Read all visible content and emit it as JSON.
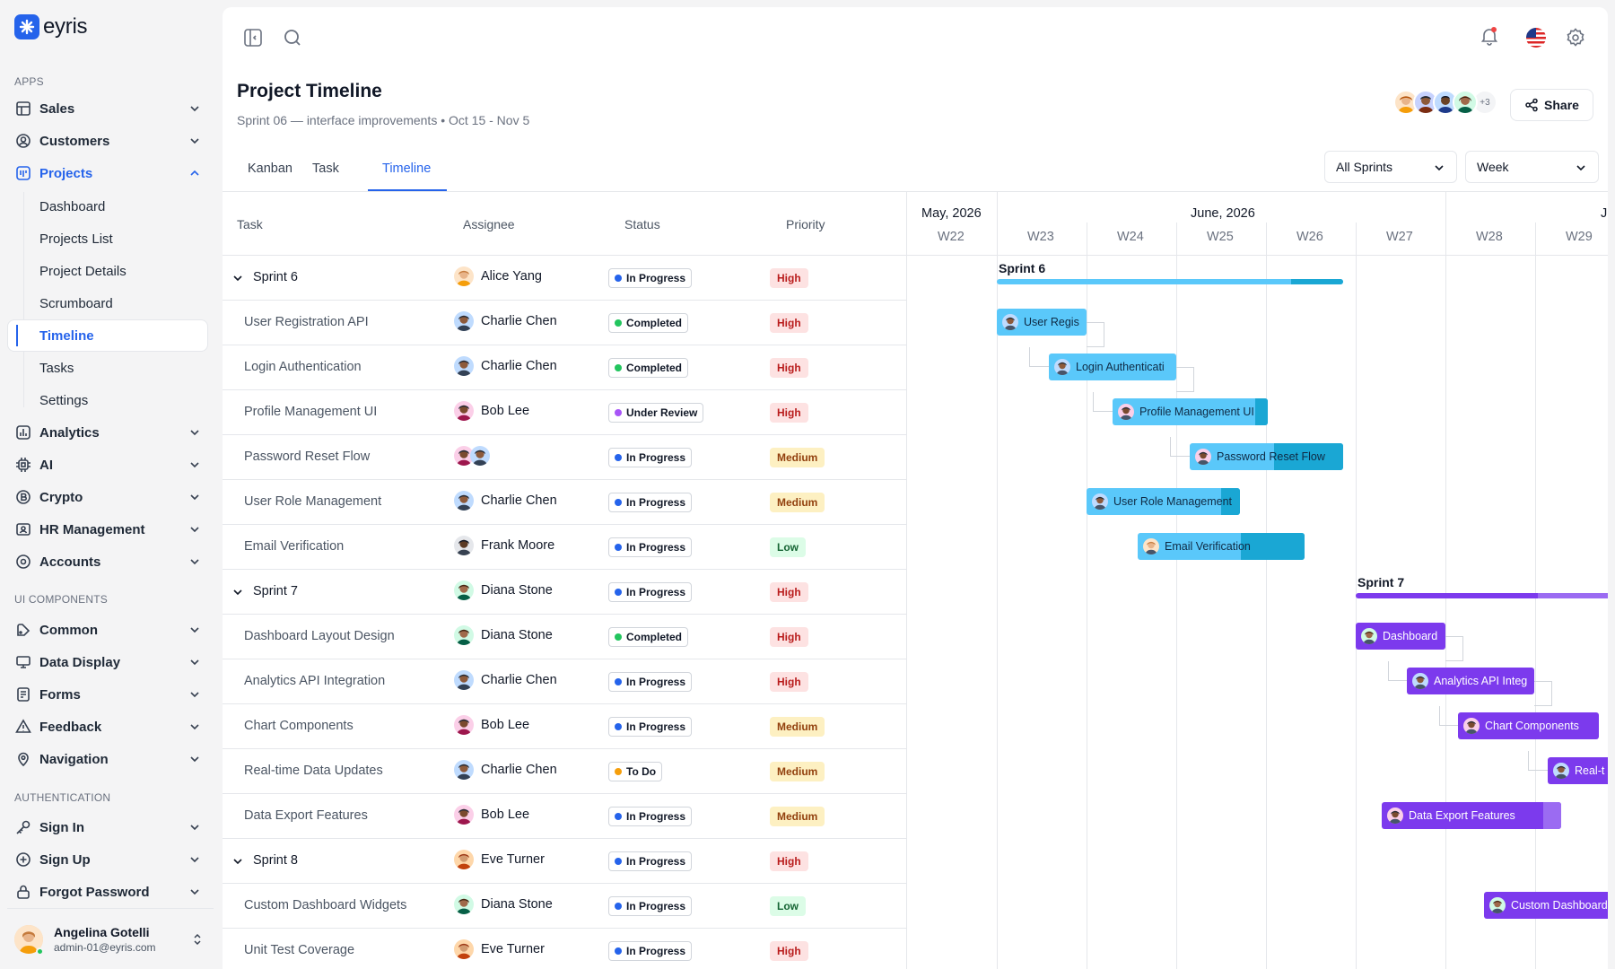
{
  "app": {
    "name": "eyris"
  },
  "sidebar": {
    "sections": {
      "apps": "APPS",
      "ui": "UI COMPONENTS",
      "auth": "AUTHENTICATION"
    },
    "items": {
      "sales": "Sales",
      "customers": "Customers",
      "projects": "Projects",
      "analytics": "Analytics",
      "ai": "AI",
      "crypto": "Crypto",
      "hr": "HR Management",
      "accounts": "Accounts",
      "common": "Common",
      "data_display": "Data Display",
      "forms": "Forms",
      "feedback": "Feedback",
      "navigation": "Navigation",
      "sign_in": "Sign In",
      "sign_up": "Sign Up",
      "forgot": "Forgot Password"
    },
    "projects_sub": [
      "Dashboard",
      "Projects List",
      "Project Details",
      "Scrumboard",
      "Timeline",
      "Tasks",
      "Settings"
    ],
    "user": {
      "name": "Angelina Gotelli",
      "email": "admin-01@eyris.com"
    }
  },
  "header": {
    "title": "Project Timeline",
    "subtitle": "Sprint 06 — interface improvements • Oct 15 - Nov 5",
    "more_members": "+3",
    "share": "Share"
  },
  "tabs": [
    "Kanban",
    "Task",
    "Timeline"
  ],
  "filters": {
    "sprint": "All Sprints",
    "range": "Week"
  },
  "table": {
    "headers": {
      "task": "Task",
      "assignee": "Assignee",
      "status": "Status",
      "priority": "Priority"
    },
    "rows": [
      {
        "task": "Sprint 6",
        "assignee": "Alice Yang",
        "status": "In Progress",
        "priority": "High"
      },
      {
        "task": "User Registration API",
        "assignee": "Charlie Chen",
        "status": "Completed",
        "priority": "High"
      },
      {
        "task": "Login Authentication",
        "assignee": "Charlie Chen",
        "status": "Completed",
        "priority": "High"
      },
      {
        "task": "Profile Management UI",
        "assignee": "Bob Lee",
        "status": "Under Review",
        "priority": "High"
      },
      {
        "task": "Password Reset Flow",
        "assignee": "",
        "status": "In Progress",
        "priority": "Medium"
      },
      {
        "task": "User Role Management",
        "assignee": "Charlie Chen",
        "status": "In Progress",
        "priority": "Medium"
      },
      {
        "task": "Email Verification",
        "assignee": "Frank Moore",
        "status": "In Progress",
        "priority": "Low"
      },
      {
        "task": "Sprint 7",
        "assignee": "Diana Stone",
        "status": "In Progress",
        "priority": "High"
      },
      {
        "task": "Dashboard Layout Design",
        "assignee": "Diana Stone",
        "status": "Completed",
        "priority": "High"
      },
      {
        "task": "Analytics API Integration",
        "assignee": "Charlie Chen",
        "status": "In Progress",
        "priority": "High"
      },
      {
        "task": "Chart Components",
        "assignee": "Bob Lee",
        "status": "In Progress",
        "priority": "Medium"
      },
      {
        "task": "Real-time Data Updates",
        "assignee": "Charlie Chen",
        "status": "To Do",
        "priority": "Medium"
      },
      {
        "task": "Data Export Features",
        "assignee": "Bob Lee",
        "status": "In Progress",
        "priority": "Medium"
      },
      {
        "task": "Sprint 8",
        "assignee": "Eve Turner",
        "status": "In Progress",
        "priority": "High"
      },
      {
        "task": "Custom Dashboard Widgets",
        "assignee": "Diana Stone",
        "status": "In Progress",
        "priority": "Low"
      },
      {
        "task": "Unit Test Coverage",
        "assignee": "Eve Turner",
        "status": "In Progress",
        "priority": "High"
      }
    ]
  },
  "timeline": {
    "months": [
      "May, 2026",
      "June, 2026",
      "Ju"
    ],
    "weeks": [
      "W22",
      "W23",
      "W24",
      "W25",
      "W26",
      "W27",
      "W28",
      "W29"
    ],
    "sprint_labels": [
      "Sprint 6",
      "Sprint 7"
    ],
    "bars": [
      "User Regis",
      "Login Authenticati",
      "Profile Management UI",
      "Password Reset Flow",
      "User Role Management",
      "Email Verification",
      "Dashboard",
      "Analytics API Integ",
      "Chart Components",
      "Real-t",
      "Data Export Features",
      "Custom Dashboard W"
    ]
  },
  "colors": {
    "accent": "#2563eb",
    "sprint6": "#5ac8fa",
    "sprint7": "#7c3aed"
  }
}
